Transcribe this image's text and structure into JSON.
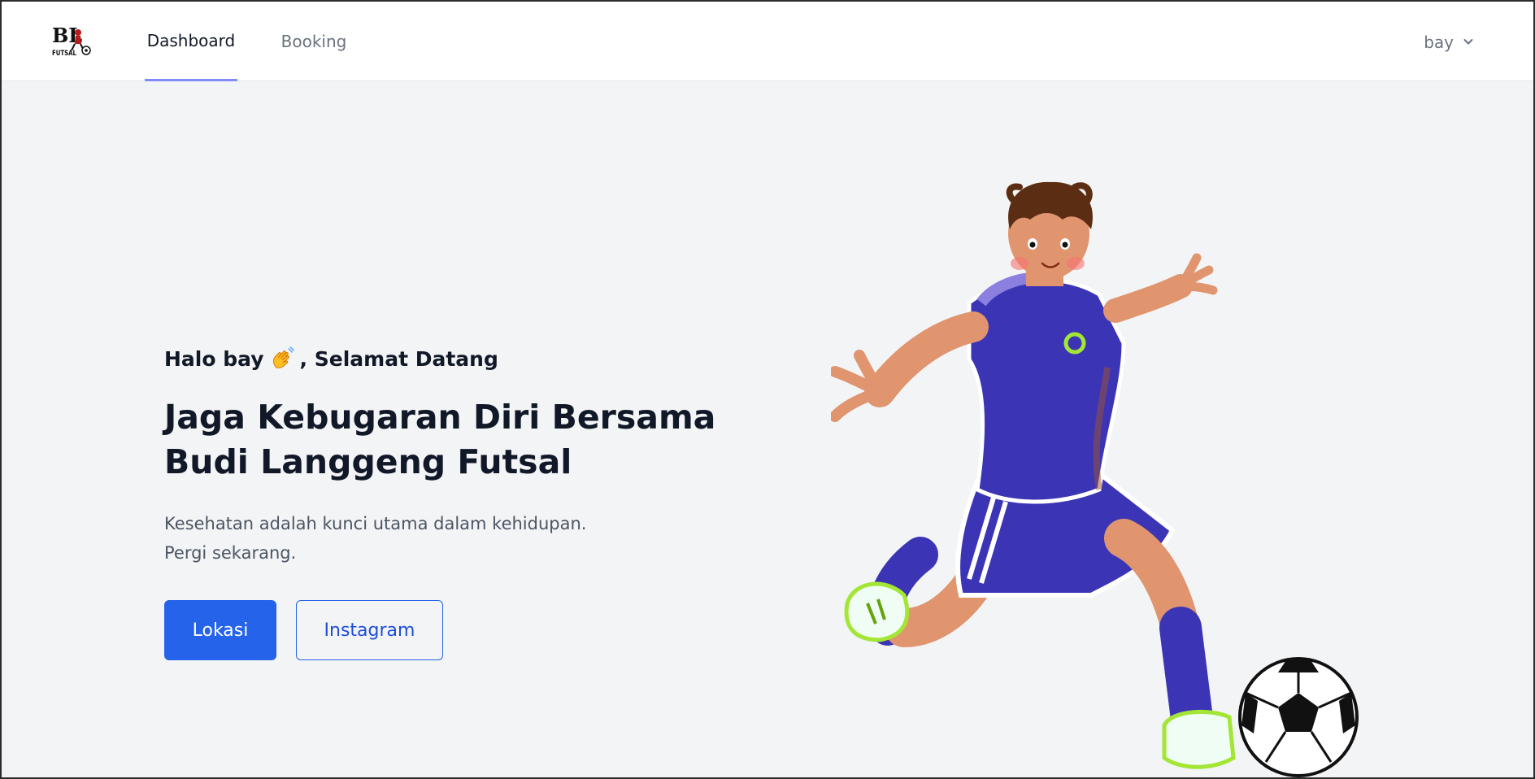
{
  "nav": {
    "logo_text": "BL FUTSAL",
    "links": [
      {
        "label": "Dashboard",
        "active": true
      },
      {
        "label": "Booking",
        "active": false
      }
    ],
    "user": {
      "name": "bay",
      "icon": "chevron-down-icon"
    }
  },
  "hero": {
    "greeting_prefix": "Halo bay",
    "greeting_icon": "waving-hand-icon",
    "greeting_suffix": ", Selamat Datang",
    "headline_line1": "Jaga Kebugaran Diri Bersama",
    "headline_line2": "Budi Langgeng Futsal",
    "subtext_line1": "Kesehatan adalah kunci utama dalam kehidupan.",
    "subtext_line2": "Pergi sekarang.",
    "primary_button": "Lokasi",
    "secondary_button": "Instagram",
    "illustration": "futsal-player-kicking-ball"
  },
  "colors": {
    "primary": "#2563eb",
    "active_underline": "#818cf8",
    "background": "#f3f4f6",
    "jersey": "#3b35b5"
  }
}
